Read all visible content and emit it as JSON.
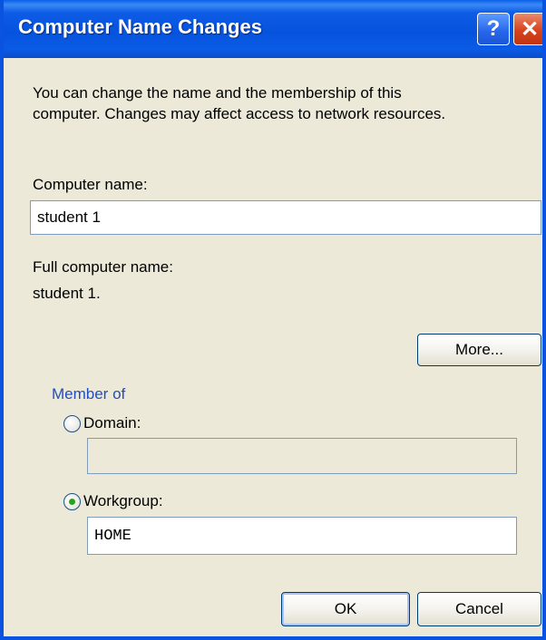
{
  "window": {
    "title": "Computer Name Changes",
    "help_glyph": "?",
    "close_glyph": "✕"
  },
  "description": {
    "line1": "You can change the name and the membership of this",
    "line2": "computer. Changes may affect access to network resources."
  },
  "computer_name": {
    "label": "Computer name:",
    "value": "student 1"
  },
  "full_computer_name": {
    "label": "Full computer name:",
    "value": "student 1."
  },
  "buttons": {
    "more": "More...",
    "ok": "OK",
    "cancel": "Cancel"
  },
  "member_of": {
    "label": "Member of",
    "domain": {
      "label": "Domain:",
      "value": "",
      "selected": false
    },
    "workgroup": {
      "label": "Workgroup:",
      "value": "HOME",
      "selected": true
    }
  },
  "colors": {
    "titlebar": "#0653DD",
    "dialog_background": "#ECE9D8",
    "group_label": "#1F4EC0",
    "radio_selected_dot": "#2D9F21",
    "close_button": "#D8431E"
  },
  "icons": {
    "help": "help-icon",
    "close": "close-icon"
  }
}
